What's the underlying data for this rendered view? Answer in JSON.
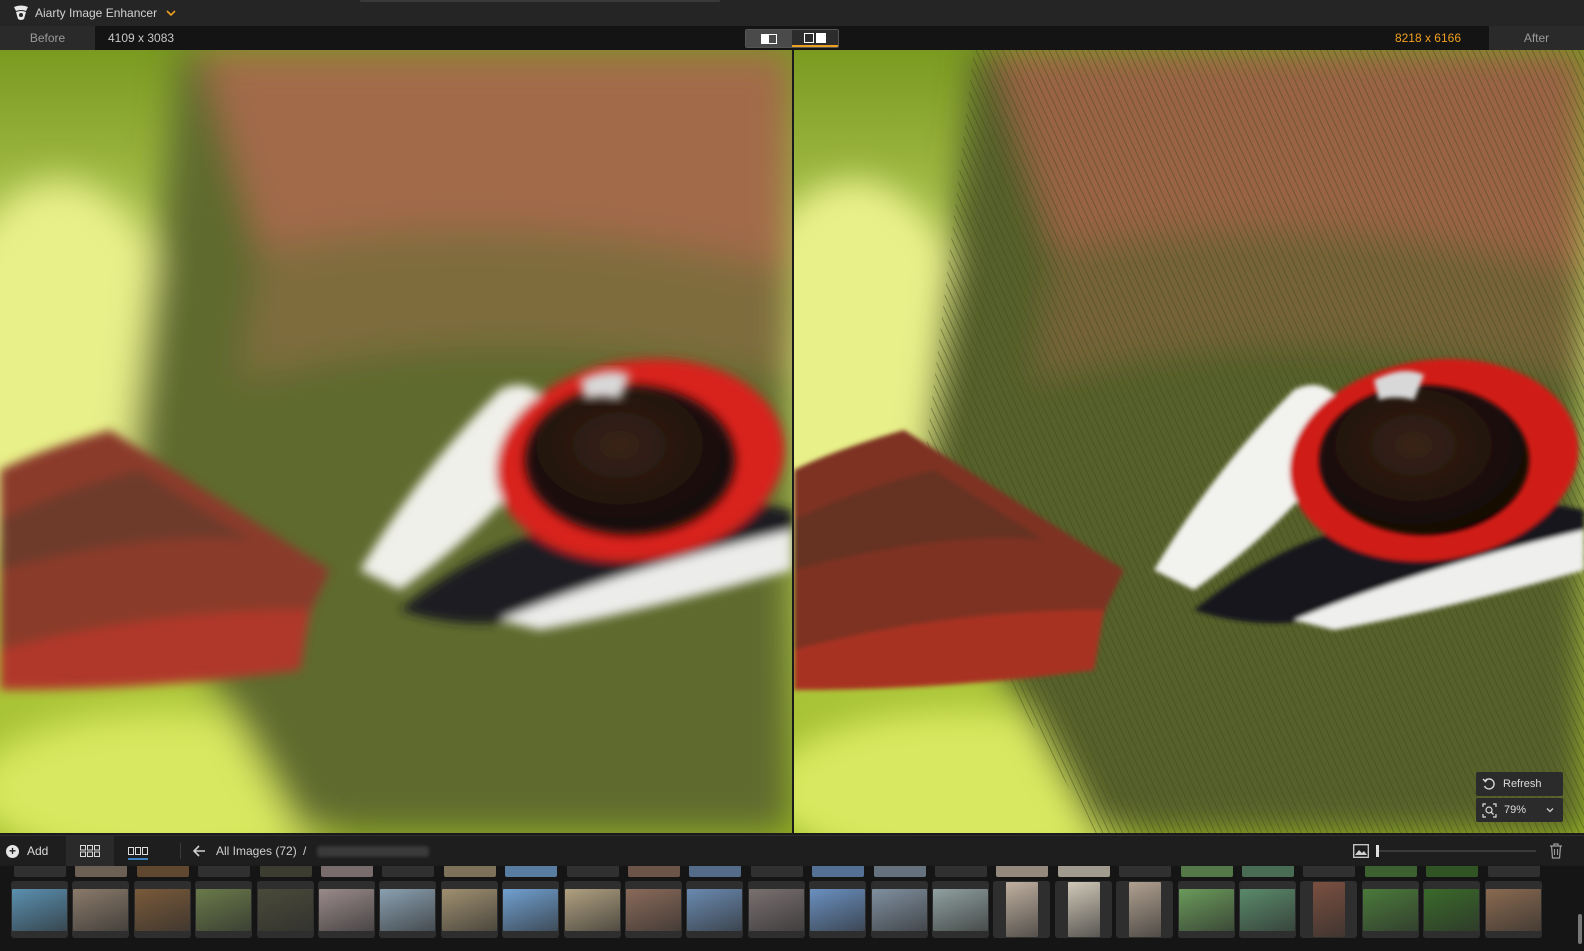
{
  "app": {
    "title": "Aiarty Image Enhancer",
    "logo_icon": "aiarty-logo-icon",
    "dropdown_icon": "chevron-down-icon"
  },
  "compare": {
    "before_label": "Before",
    "before_size": "4109 x 3083",
    "after_size": "8218 x 6166",
    "after_label": "After",
    "view_modes": [
      "single-view-icon",
      "side-by-side-icon"
    ],
    "active_view": "side-by-side-icon",
    "accent_color": "#f0a020"
  },
  "preview": {
    "refresh_label": "Refresh",
    "zoom_value": "79%"
  },
  "toolbar": {
    "add_label": "Add",
    "breadcrumb_all": "All Images (72)",
    "breadcrumb_separator": "/"
  },
  "filmstrip": {
    "thumbnails": [
      {
        "color": "#5a90b0"
      },
      {
        "color": "#8a7a6a"
      },
      {
        "color": "#7a5a3a"
      },
      {
        "color": "#6a7a4a"
      },
      {
        "color": "#4a4a3a"
      },
      {
        "color": "#9a8a8a"
      },
      {
        "color": "#8aa0b0"
      },
      {
        "color": "#a09070"
      },
      {
        "color": "#70a0d0"
      },
      {
        "color": "#b0a080"
      },
      {
        "color": "#8a6a5a"
      },
      {
        "color": "#6a8ab0"
      },
      {
        "color": "#7a7070"
      },
      {
        "color": "#6a90c0"
      },
      {
        "color": "#8090a0"
      },
      {
        "color": "#90a0a0"
      },
      {
        "color": "#c0b0a0"
      },
      {
        "color": "#d0c8b8"
      },
      {
        "color": "#b0a090"
      },
      {
        "color": "#6a9a5a"
      },
      {
        "color": "#5a8a6a"
      },
      {
        "color": "#7a5040"
      },
      {
        "color": "#4a7a3a"
      },
      {
        "color": "#3a6a2a"
      },
      {
        "color": "#8a6a50"
      }
    ]
  }
}
